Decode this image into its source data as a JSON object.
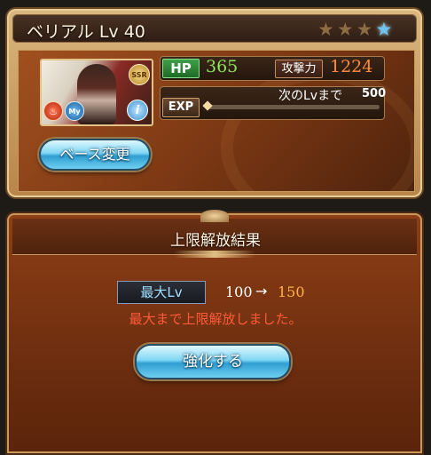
{
  "character": {
    "name": "ベリアル Lv 40",
    "rarity_badge": "SSR",
    "my_badge": "My",
    "element_icon": "fire-element-icon",
    "info_icon": "info-icon",
    "stars_total": 4,
    "stars_lit": 1
  },
  "stats": {
    "hp_label": "HP",
    "hp_value": "365",
    "atk_label": "攻撃力",
    "atk_value": "1224",
    "exp_label": "EXP",
    "next_lv_label": "次のLvまで",
    "next_lv_value": "500",
    "exp_progress": 0.0
  },
  "buttons": {
    "base_change": "ベース変更",
    "enhance": "強化する"
  },
  "result": {
    "title": "上限解放結果",
    "max_lv_label": "最大Lv",
    "lv_from": "100",
    "arrow": "→",
    "lv_to": "150",
    "message": "最大まで上限解放しました。"
  },
  "colors": {
    "hp_value": "#90e35e",
    "atk_value": "#ff8a3a",
    "lv_to": "#ffb24a",
    "message": "#ff5a3a",
    "star_lit": "#6ec3f2"
  }
}
